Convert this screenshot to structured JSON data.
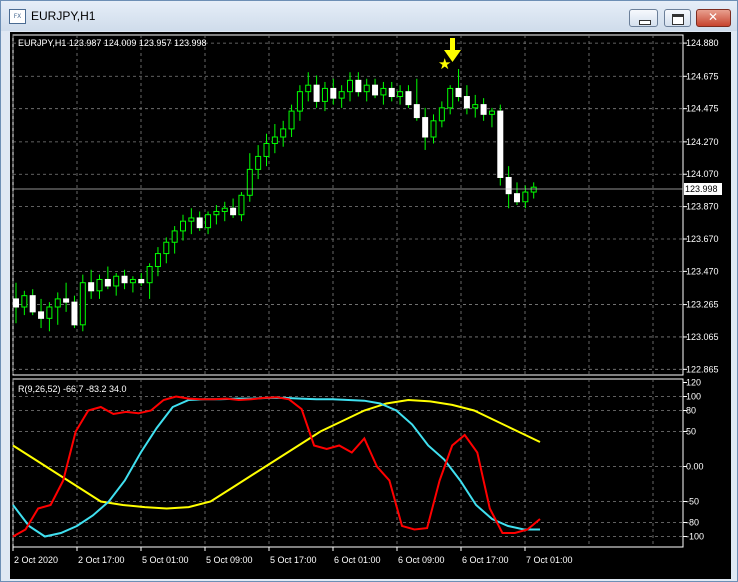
{
  "window": {
    "title": "EURJPY,H1",
    "icon": "chart-window-icon"
  },
  "main_chart": {
    "info": "EURJPY,H1  123.987 124.009 123.957 123.998",
    "price_axis": [
      "124.880",
      "124.675",
      "124.475",
      "124.270",
      "124.070",
      "123.870",
      "123.670",
      "123.470",
      "123.265",
      "123.065",
      "122.865"
    ],
    "current_price": "123.998",
    "candle_color": "#ffffff",
    "wick_color": "#00ff00",
    "marker_star_color": "#ffff00",
    "marker_arrow_color": "#ffff00"
  },
  "indicator": {
    "label": "R(9,26,52) -66.7 -83.2 34.0",
    "axis": [
      "120",
      "100",
      "80",
      "50",
      "0.00",
      "-50",
      "-80",
      "-100"
    ],
    "colors": {
      "red": "#ff0000",
      "cyan": "#40e0f0",
      "yellow": "#ffff00"
    }
  },
  "time_axis": [
    "2 Oct 2020",
    "2 Oct 17:00",
    "5 Oct 01:00",
    "5 Oct 09:00",
    "5 Oct 17:00",
    "6 Oct 01:00",
    "6 Oct 09:00",
    "6 Oct 17:00",
    "7 Oct 01:00"
  ],
  "candles": [
    [
      123.3,
      123.4,
      123.15,
      123.25
    ],
    [
      123.25,
      123.35,
      123.2,
      123.32
    ],
    [
      123.32,
      123.36,
      123.2,
      123.22
    ],
    [
      123.22,
      123.3,
      123.12,
      123.18
    ],
    [
      123.18,
      123.28,
      123.1,
      123.25
    ],
    [
      123.25,
      123.34,
      123.14,
      123.3
    ],
    [
      123.3,
      123.4,
      123.22,
      123.28
    ],
    [
      123.28,
      123.32,
      123.12,
      123.14
    ],
    [
      123.14,
      123.45,
      123.1,
      123.4
    ],
    [
      123.4,
      123.48,
      123.3,
      123.35
    ],
    [
      123.35,
      123.45,
      123.3,
      123.42
    ],
    [
      123.42,
      123.5,
      123.36,
      123.38
    ],
    [
      123.38,
      123.46,
      123.32,
      123.44
    ],
    [
      123.44,
      123.48,
      123.36,
      123.4
    ],
    [
      123.4,
      123.44,
      123.34,
      123.42
    ],
    [
      123.42,
      123.46,
      123.38,
      123.4
    ],
    [
      123.4,
      123.52,
      123.3,
      123.5
    ],
    [
      123.5,
      123.62,
      123.44,
      123.58
    ],
    [
      123.58,
      123.68,
      123.52,
      123.65
    ],
    [
      123.65,
      123.75,
      123.58,
      123.72
    ],
    [
      123.72,
      123.82,
      123.66,
      123.78
    ],
    [
      123.78,
      123.86,
      123.7,
      123.8
    ],
    [
      123.8,
      123.84,
      123.72,
      123.74
    ],
    [
      123.74,
      123.84,
      123.7,
      123.82
    ],
    [
      123.82,
      123.88,
      123.76,
      123.84
    ],
    [
      123.84,
      123.9,
      123.78,
      123.86
    ],
    [
      123.86,
      123.92,
      123.8,
      123.82
    ],
    [
      123.82,
      123.96,
      123.78,
      123.94
    ],
    [
      123.94,
      124.2,
      123.9,
      124.1
    ],
    [
      124.1,
      124.25,
      124.04,
      124.18
    ],
    [
      124.18,
      124.32,
      124.12,
      124.26
    ],
    [
      124.26,
      124.38,
      124.2,
      124.3
    ],
    [
      124.3,
      124.4,
      124.24,
      124.35
    ],
    [
      124.35,
      124.5,
      124.3,
      124.46
    ],
    [
      124.46,
      124.62,
      124.4,
      124.58
    ],
    [
      124.58,
      124.7,
      124.52,
      124.62
    ],
    [
      124.62,
      124.68,
      124.48,
      124.52
    ],
    [
      124.52,
      124.64,
      124.46,
      124.6
    ],
    [
      124.6,
      124.66,
      124.5,
      124.54
    ],
    [
      124.54,
      124.62,
      124.48,
      124.58
    ],
    [
      124.58,
      124.7,
      124.52,
      124.65
    ],
    [
      124.65,
      124.7,
      124.55,
      124.58
    ],
    [
      124.58,
      124.66,
      124.52,
      124.62
    ],
    [
      124.62,
      124.66,
      124.54,
      124.56
    ],
    [
      124.56,
      124.64,
      124.5,
      124.6
    ],
    [
      124.6,
      124.64,
      124.52,
      124.55
    ],
    [
      124.55,
      124.62,
      124.5,
      124.58
    ],
    [
      124.58,
      124.62,
      124.48,
      124.5
    ],
    [
      124.5,
      124.66,
      124.4,
      124.42
    ],
    [
      124.42,
      124.48,
      124.22,
      124.3
    ],
    [
      124.3,
      124.44,
      124.26,
      124.4
    ],
    [
      124.4,
      124.52,
      124.36,
      124.48
    ],
    [
      124.48,
      124.62,
      124.44,
      124.6
    ],
    [
      124.6,
      124.72,
      124.52,
      124.55
    ],
    [
      124.55,
      124.62,
      124.44,
      124.48
    ],
    [
      124.48,
      124.56,
      124.42,
      124.5
    ],
    [
      124.5,
      124.54,
      124.4,
      124.44
    ],
    [
      124.44,
      124.48,
      124.36,
      124.46
    ],
    [
      124.46,
      124.5,
      124.0,
      124.05
    ],
    [
      124.05,
      124.12,
      123.86,
      123.95
    ],
    [
      123.95,
      124.02,
      123.88,
      123.9
    ],
    [
      123.9,
      124.0,
      123.86,
      123.96
    ],
    [
      123.96,
      124.02,
      123.92,
      123.99
    ]
  ],
  "rsi": {
    "red": [
      -100,
      -90,
      -60,
      -55,
      -20,
      50,
      80,
      85,
      75,
      78,
      76,
      80,
      95,
      100,
      97,
      96,
      96,
      97,
      95,
      96,
      98,
      99,
      96,
      82,
      30,
      25,
      30,
      20,
      40,
      0,
      -20,
      -85,
      -90,
      -88,
      -20,
      30,
      45,
      20,
      -60,
      -95,
      -95,
      -90,
      -75
    ],
    "cyan": [
      -55,
      -85,
      -100,
      -95,
      -85,
      -70,
      -50,
      -20,
      20,
      55,
      85,
      95,
      96,
      96,
      97,
      97,
      98,
      98,
      97,
      96,
      96,
      95,
      94,
      90,
      80,
      60,
      30,
      10,
      -20,
      -55,
      -75,
      -85,
      -90,
      -90
    ],
    "yellow": [
      30,
      10,
      -10,
      -30,
      -50,
      -55,
      -58,
      -60,
      -58,
      -50,
      -30,
      -10,
      10,
      30,
      50,
      65,
      80,
      90,
      95,
      93,
      88,
      80,
      65,
      50,
      35
    ]
  }
}
